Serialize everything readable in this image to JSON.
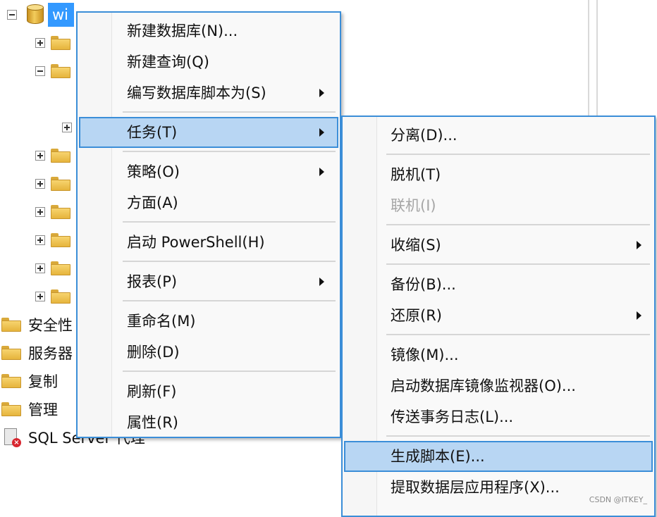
{
  "tree": {
    "database_label": "wi",
    "nodes": [
      "安全性",
      "服务器",
      "复制",
      "管理",
      "SQL Server 代理"
    ]
  },
  "context_menu": {
    "items": [
      {
        "label": "新建数据库(N)...",
        "submenu": false
      },
      {
        "label": "新建查询(Q)",
        "submenu": false
      },
      {
        "label": "编写数据库脚本为(S)",
        "submenu": true
      },
      {
        "label": "任务(T)",
        "submenu": true,
        "highlighted": true
      },
      {
        "label": "策略(O)",
        "submenu": true
      },
      {
        "label": "方面(A)",
        "submenu": false
      },
      {
        "label": "启动 PowerShell(H)",
        "submenu": false
      },
      {
        "label": "报表(P)",
        "submenu": true
      },
      {
        "label": "重命名(M)",
        "submenu": false
      },
      {
        "label": "删除(D)",
        "submenu": false
      },
      {
        "label": "刷新(F)",
        "submenu": false
      },
      {
        "label": "属性(R)",
        "submenu": false
      }
    ]
  },
  "tasks_submenu": {
    "items": [
      {
        "label": "分离(D)...",
        "enabled": true
      },
      {
        "label": "脱机(T)",
        "enabled": true
      },
      {
        "label": "联机(I)",
        "enabled": false
      },
      {
        "label": "收缩(S)",
        "enabled": true,
        "submenu": true
      },
      {
        "label": "备份(B)...",
        "enabled": true
      },
      {
        "label": "还原(R)",
        "enabled": true,
        "submenu": true
      },
      {
        "label": "镜像(M)...",
        "enabled": true
      },
      {
        "label": "启动数据库镜像监视器(O)...",
        "enabled": true
      },
      {
        "label": "传送事务日志(L)...",
        "enabled": true
      },
      {
        "label": "生成脚本(E)...",
        "enabled": true,
        "highlighted": true
      },
      {
        "label": "提取数据层应用程序(X)...",
        "enabled": true
      }
    ]
  },
  "watermark": "CSDN @ITKEY_",
  "colors": {
    "selection": "#3399ff",
    "menu_highlight": "#b8d6f3",
    "menu_border": "#3b8ed8"
  }
}
